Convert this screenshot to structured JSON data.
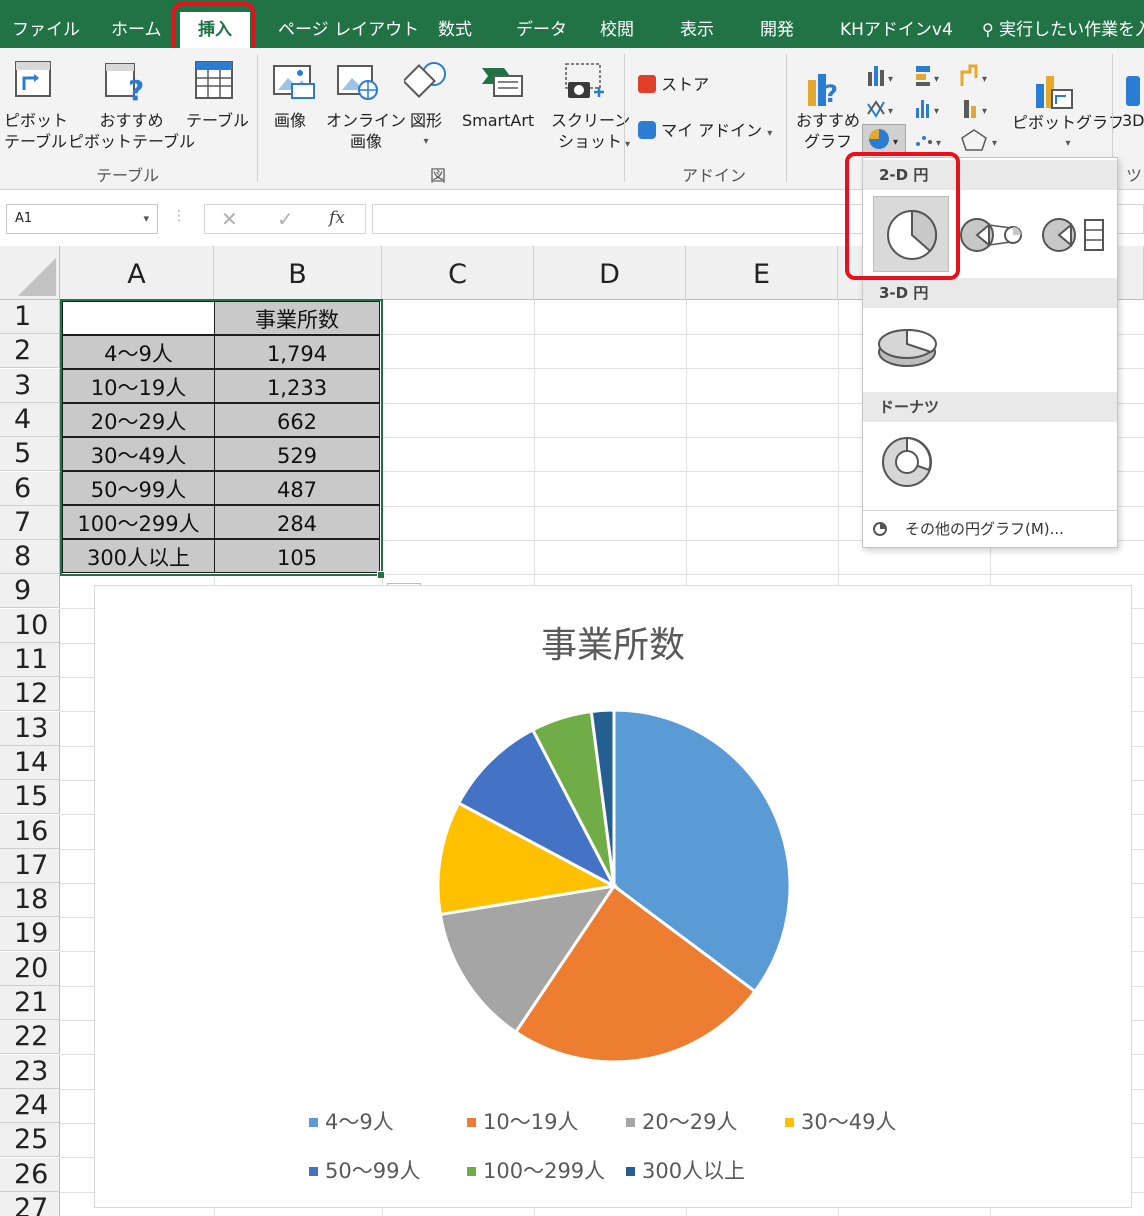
{
  "ribbon_tabs": [
    "ファイル",
    "ホーム",
    "挿入",
    "ページ レイアウト",
    "数式",
    "データ",
    "校閲",
    "表示",
    "開発",
    "KHアドインv4",
    "実行したい作業を入"
  ],
  "active_tab": "挿入",
  "ribbon": {
    "pivot_table": [
      "ピボット",
      "テーブル"
    ],
    "recommended_pivot": [
      "おすすめ",
      "ピボットテーブル"
    ],
    "table": "テーブル",
    "group_table": "テーブル",
    "image": "画像",
    "online_image": [
      "オンライン",
      "画像"
    ],
    "shapes": "図形",
    "smartart": "SmartArt",
    "screenshot": [
      "スクリーン",
      "ショット"
    ],
    "group_illustrations": "図",
    "store": "ストア",
    "my_addins": "マイ アドイン",
    "group_addins": "アドイン",
    "recommended_charts": [
      "おすすめ",
      "グラフ"
    ],
    "pivot_chart": "ピボットグラフ",
    "3d_map": [
      "3D"
    ],
    "group_tours": "ツ"
  },
  "formula_bar": {
    "name_box": "A1",
    "fx": "fx",
    "formula": ""
  },
  "columns": [
    "A",
    "B",
    "C",
    "D",
    "E"
  ],
  "rows": [
    "1",
    "2",
    "3",
    "4",
    "5",
    "6",
    "7",
    "8",
    "9",
    "10",
    "11",
    "12",
    "13",
    "14",
    "15",
    "16",
    "17",
    "18",
    "19",
    "20",
    "21",
    "22",
    "23",
    "24",
    "25",
    "26",
    "27"
  ],
  "table": {
    "header": "事業所数",
    "labels": [
      "4～9人",
      "10～19人",
      "20～29人",
      "30～49人",
      "50～99人",
      "100～299人",
      "300人以上"
    ],
    "values": [
      "1,794",
      "1,233",
      "662",
      "529",
      "487",
      "284",
      "105"
    ]
  },
  "pie_menu": {
    "section_2d": "2-D 円",
    "section_3d": "3-D 円",
    "section_donut": "ドーナツ",
    "more": "その他の円グラフ(M)..."
  },
  "colors": {
    "excel_green": "#217346",
    "highlight_red": "#e8101a"
  },
  "chart_data": {
    "type": "pie",
    "title": "事業所数",
    "categories": [
      "4～9人",
      "10～19人",
      "20～29人",
      "30～49人",
      "50～99人",
      "100～299人",
      "300人以上"
    ],
    "values": [
      1794,
      1233,
      662,
      529,
      487,
      284,
      105
    ],
    "colors": [
      "#5b9bd5",
      "#ed7d31",
      "#a5a5a5",
      "#ffc000",
      "#4472c4",
      "#70ad47",
      "#255e91"
    ],
    "legend_position": "bottom"
  }
}
